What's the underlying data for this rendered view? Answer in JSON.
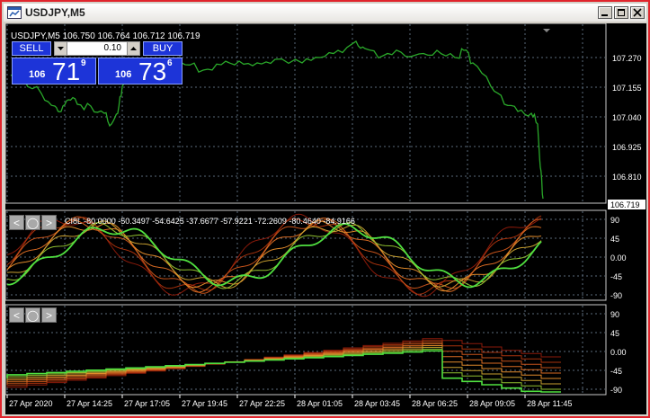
{
  "window": {
    "title": "USDJPY,M5"
  },
  "chart": {
    "info_line": "USDJPY,M5  106.750 106.764 106.712 106.719",
    "price_ticks": [
      "107.270",
      "107.155",
      "107.040",
      "106.925",
      "106.810"
    ],
    "current_price": "106.719",
    "time_labels": [
      "27 Apr 2020",
      "27 Apr 14:25",
      "27 Apr 17:05",
      "27 Apr 19:45",
      "27 Apr 22:25",
      "28 Apr 01:05",
      "28 Apr 03:45",
      "28 Apr 06:25",
      "28 Apr 09:05",
      "28 Apr 11:45"
    ]
  },
  "trade_panel": {
    "sell_label": "SELL",
    "buy_label": "BUY",
    "lot": "0.10",
    "bid_prefix": "106",
    "bid_big": "71",
    "bid_sup": "9",
    "ask_prefix": "106",
    "ask_big": "73",
    "ask_sup": "6"
  },
  "indicator1": {
    "label": "CI8L -80.0000 -50.3497 -54.6425 -37.6677 -57.9221 -72.2609 -80.4640 -84.9166",
    "ticks": [
      "90",
      "45",
      "0.00",
      "-45",
      "-90"
    ]
  },
  "indicator2": {
    "ticks": [
      "90",
      "45",
      "0.00",
      "-45",
      "-90"
    ]
  },
  "colors": {
    "price": "#2aa82a",
    "grid": "#5a6a7a",
    "panel": "#1d34d8"
  }
}
